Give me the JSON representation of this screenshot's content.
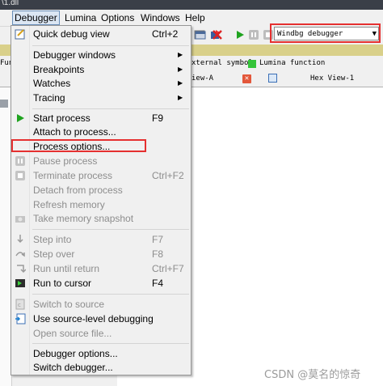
{
  "window": {
    "title_fragment": "\\1.dll"
  },
  "menubar": {
    "items": [
      {
        "label": "Debugger",
        "active": true
      },
      {
        "label": "Lumina"
      },
      {
        "label": "Options"
      },
      {
        "label": "Windows"
      },
      {
        "label": "Help"
      }
    ]
  },
  "toolbar": {
    "debugger_select": "Windbg debugger"
  },
  "legend": {
    "left": "Fun",
    "external": "xternal symbol",
    "lumina": "Lumina function"
  },
  "tabs": {
    "ida_view": "iew-A",
    "hex_view": "Hex View-1"
  },
  "menu": {
    "quick_debug": {
      "label": "Quick debug view",
      "shortcut": "Ctrl+2"
    },
    "debugger_windows": "Debugger windows",
    "breakpoints": "Breakpoints",
    "watches": "Watches",
    "tracing": "Tracing",
    "start_process": {
      "label": "Start process",
      "shortcut": "F9"
    },
    "attach_process": "Attach to process...",
    "process_options": "Process options...",
    "pause_process": "Pause process",
    "terminate_process": {
      "label": "Terminate process",
      "shortcut": "Ctrl+F2"
    },
    "detach_process": "Detach from process",
    "refresh_memory": "Refresh memory",
    "take_snapshot": "Take memory snapshot",
    "step_into": {
      "label": "Step into",
      "shortcut": "F7"
    },
    "step_over": {
      "label": "Step over",
      "shortcut": "F8"
    },
    "run_until_return": {
      "label": "Run until return",
      "shortcut": "Ctrl+F7"
    },
    "run_to_cursor": {
      "label": "Run to cursor",
      "shortcut": "F4"
    },
    "switch_to_source": "Switch to source",
    "use_source_debugging": "Use source-level debugging",
    "open_source_file": "Open source file...",
    "debugger_options": "Debugger options...",
    "switch_debugger": "Switch debugger..."
  },
  "watermark": "CSDN @莫名的惊奇",
  "colors": {
    "highlight_box": "#e53030",
    "lumina_green": "#35c43a",
    "nav_band": "#d9d08a"
  }
}
